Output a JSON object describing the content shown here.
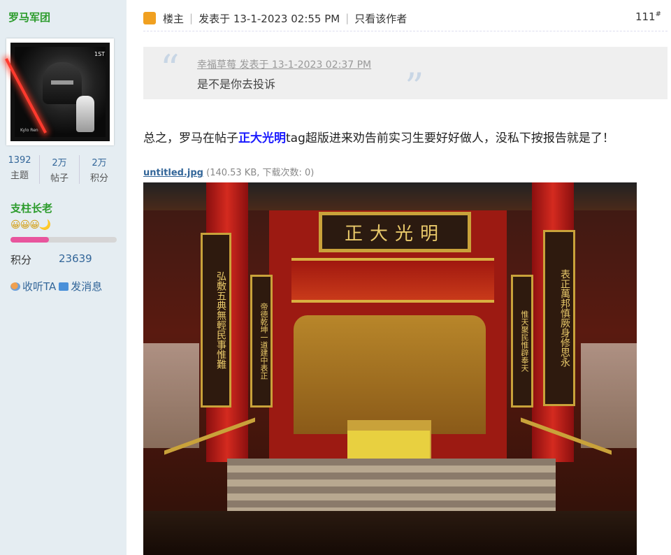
{
  "user": {
    "name": "罗马军团",
    "avatar": {
      "stamp_value": "1ST",
      "stamp_caption": "Kylo Ren"
    },
    "stats": [
      {
        "num": "1392",
        "label": "主题"
      },
      {
        "num": "2万",
        "label": "帖子"
      },
      {
        "num": "2万",
        "label": "积分"
      }
    ],
    "rank": "支柱长老",
    "rank_icons": "😀😀😀🌙",
    "rank_progress_percent": 36,
    "points_label": "积分",
    "points_value": "23639",
    "follow_label": "收听TA",
    "message_label": "发消息"
  },
  "post": {
    "author_role": "楼主",
    "posted_at": "发表于 13-1-2023 02:55 PM",
    "only_author": "只看该作者",
    "floor": "111",
    "floor_mark": "#",
    "quote": {
      "meta": "幸福草莓 发表于 13-1-2023 02:37 PM",
      "text": "是不是你去投诉"
    },
    "text_before": "总之，罗马在帖子",
    "link": "正大光明",
    "text_after": "tag超版进来劝告前实习生要好好做人，没私下按报告就是了！",
    "attachment": {
      "name": "untitled.jpg",
      "info": " (140.53 KB, 下载次数: 0)"
    },
    "photo": {
      "plaque": "正大光明",
      "couplet_outer_left": "弘敷五典無輕民事惟難",
      "couplet_inner_left": "帝德乾坤一道建中表正",
      "couplet_inner_right": "惟天聚民惟辟奉天",
      "couplet_outer_right": "表正萬邦慎厥身修思永"
    }
  },
  "colors": {
    "sidebar_bg": "#e5edf2",
    "rank_green": "#2b9b2b",
    "link_blue": "#336699",
    "post_link": "#1a1aff"
  }
}
